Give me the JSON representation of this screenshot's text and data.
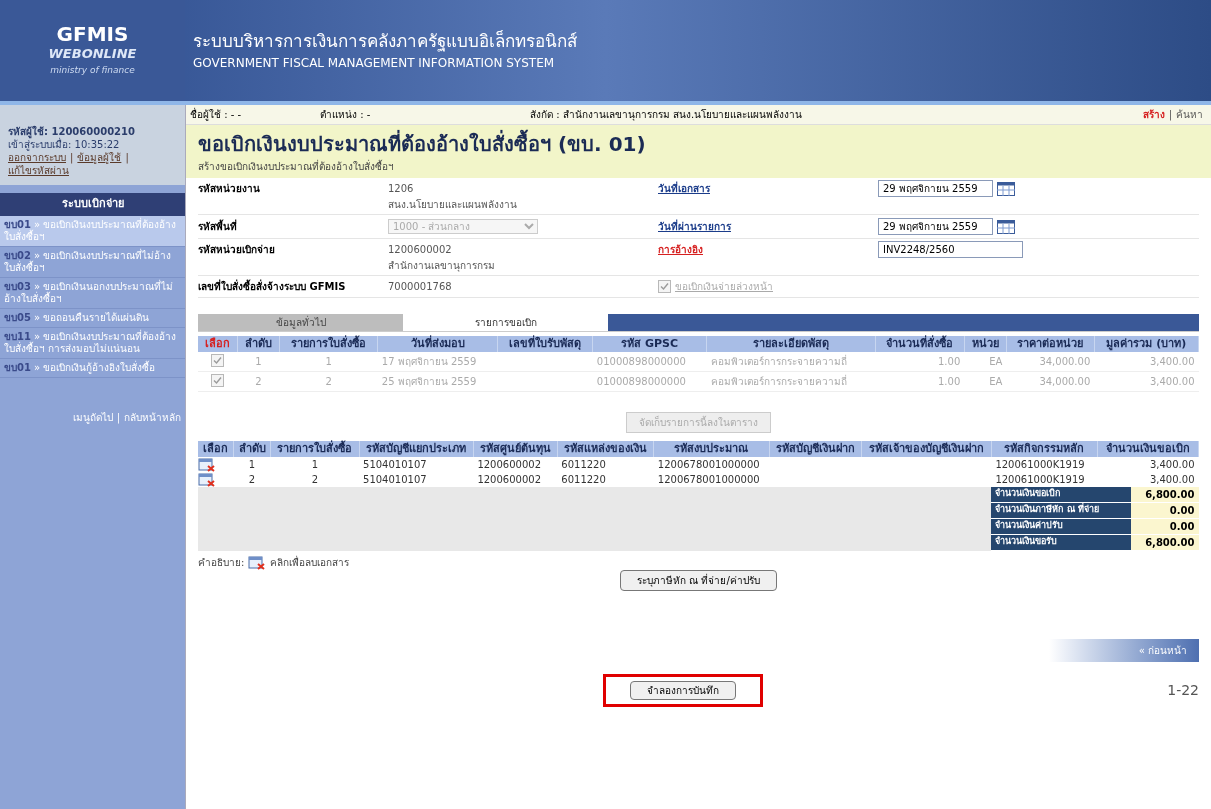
{
  "header": {
    "logo_line1": "GFMIS",
    "logo_line2": "WEBONLINE",
    "logo_line3": "ministry of finance",
    "title_th": "ระบบบริหารการเงินการคลังภาครัฐแบบอิเล็กทรอนิกส์",
    "title_en": "GOVERNMENT FISCAL MANAGEMENT INFORMATION SYSTEM"
  },
  "sidebar": {
    "user_id": "รหัสผู้ใช้: 120060000210",
    "login_time_label": "เข้าสู่ระบบเมื่อ:",
    "login_time": "10:35:22",
    "links": [
      "ออกจากระบบ",
      "ข้อมูลผู้ใช้",
      "แก้ไขรหัสผ่าน"
    ],
    "separator": "|",
    "menu_title": "ระบบเบิกจ่าย",
    "items": [
      {
        "code": "ขบ01",
        "label": "» ขอเบิกเงินงบประมาณที่ต้องอ้างใบสั่งซื้อฯ",
        "selected": true
      },
      {
        "code": "ขบ02",
        "label": "» ขอเบิกเงินงบประมาณที่ไม่อ้างใบสั่งซื้อฯ",
        "selected": false
      },
      {
        "code": "ขบ03",
        "label": "» ขอเบิกเงินนอกงบประมาณที่ไม่อ้างใบสั่งซื้อฯ",
        "selected": false
      },
      {
        "code": "ขบ05",
        "label": "» ขอถอนคืนรายได้แผ่นดิน",
        "selected": false
      },
      {
        "code": "ขบ11",
        "label": "» ขอเบิกเงินงบประมาณที่ต้องอ้างใบสั่งซื้อฯ การส่งมอบไม่แน่นอน",
        "selected": false
      },
      {
        "code": "ขบ01",
        "label": "» ขอเบิกเงินกู้อ้างอิงใบสั่งซื้อ",
        "selected": false
      }
    ],
    "footer_links": [
      "เมนูถัดไป",
      "กลับหน้าหลัก"
    ]
  },
  "top_bar": {
    "user_label": "ชื่อผู้ใช้ :",
    "user_value": "- -",
    "position_label": "ตำแหน่ง :",
    "position_value": "-",
    "affiliation_label": "สังกัด :",
    "affiliation_value": "สำนักงานเลขานุการกรม สนง.นโยบายและแผนพลังงาน",
    "actions": [
      {
        "label": "สร้าง",
        "selected": true
      },
      {
        "label": "ค้นหา",
        "selected": false
      }
    ],
    "separator": "|"
  },
  "page": {
    "title": "ขอเบิกเงินงบประมาณที่ต้องอ้างใบสั่งซื้อฯ (ขบ. 01)",
    "subtitle": "สร้างขอเบิกเงินงบประมาณที่ต้องอ้างใบสั่งซื้อฯ"
  },
  "form": {
    "agency_label": "รหัสหน่วยงาน",
    "agency_code": "1206",
    "agency_name": "สนง.นโยบายและแผนพลังงาน",
    "doc_date_label": "วันที่เอกสาร",
    "doc_date": "29 พฤศจิกายน 2559",
    "area_label": "รหัสพื้นที่",
    "area_value": "1000 - ส่วนกลาง",
    "post_date_label": "วันที่ผ่านรายการ",
    "post_date": "29 พฤศจิกายน 2559",
    "unit_label": "รหัสหน่วยเบิกจ่าย",
    "unit_code": "1200600002",
    "unit_name": "สำนักงานเลขานุการกรม",
    "reference_label": "การอ้างอิง",
    "reference": "INV2248/2560",
    "po_label": "เลขที่ใบสั่งซื้อสั่งจ้างระบบ GFMIS",
    "po_number": "7000001768",
    "advance_label": "ขอเบิกเงินจ่ายล่วงหน้า",
    "advance_checked": true
  },
  "tabs": [
    {
      "label": "ข้อมูลทั่วไป",
      "selected": false
    },
    {
      "label": "รายการขอเบิก",
      "selected": true
    }
  ],
  "items_table": {
    "columns": [
      "เลือก",
      "ลำดับ",
      "รายการใบสั่งซื้อ",
      "วันที่ส่งมอบ",
      "เลขที่ใบรับพัสดุ",
      "รหัส GPSC",
      "รายละเอียดพัสดุ",
      "จำนวนที่สั่งซื้อ",
      "หน่วย",
      "ราคาต่อหน่วย",
      "มูลค่ารวม (บาท)"
    ],
    "rows": [
      {
        "checked": true,
        "cells": [
          "",
          "1",
          "1",
          "17 พฤศจิกายน 2559",
          "",
          "01000898000000",
          "คอมพิวเตอร์การกระจายความถี่",
          "1.00",
          "EA",
          "34,000.00",
          "3,400.00"
        ]
      },
      {
        "checked": true,
        "cells": [
          "",
          "2",
          "2",
          "25 พฤศจิกายน 2559",
          "",
          "01000898000000",
          "คอมพิวเตอร์การกระจายความถี่",
          "1.00",
          "EA",
          "34,000.00",
          "3,400.00"
        ]
      }
    ]
  },
  "store_button": "จัดเก็บรายการนี้ลงในตาราง",
  "accounts_table": {
    "columns": [
      "เลือก",
      "ลำดับ",
      "รายการใบสั่งซื้อ",
      "รหัสบัญชีแยกประเภท",
      "รหัสศูนย์ต้นทุน",
      "รหัสแหล่งของเงิน",
      "รหัสงบประมาณ",
      "รหัสบัญชีเงินฝาก",
      "รหัสเจ้าของบัญชีเงินฝาก",
      "รหัสกิจกรรมหลัก",
      "จำนวนเงินขอเบิก"
    ],
    "rows": [
      [
        "",
        "1",
        "1",
        "5104010107",
        "1200600002",
        "6011220",
        "1200678001000000",
        "",
        "",
        "120061000K1919",
        "3,400.00"
      ],
      [
        "",
        "2",
        "2",
        "5104010107",
        "1200600002",
        "6011220",
        "1200678001000000",
        "",
        "",
        "120061000K1919",
        "3,400.00"
      ]
    ],
    "totals": [
      {
        "label": "จำนวนเงินขอเบิก",
        "value": "6,800.00"
      },
      {
        "label": "จำนวนเงินภาษีหัก ณ ที่จ่าย",
        "value": "0.00"
      },
      {
        "label": "จำนวนเงินค่าปรับ",
        "value": "0.00"
      },
      {
        "label": "จำนวนเงินขอรับ",
        "value": "6,800.00"
      }
    ]
  },
  "legend": {
    "label": "คำอธิบาย:",
    "text": "คลิกเพื่อลบเอกสาร"
  },
  "tax_button": "ระบุภาษีหัก ณ ที่จ่าย/ค่าปรับ",
  "back_link": "« ก่อนหน้า",
  "save_button": "จำลองการบันทึก",
  "page_number": "1-22"
}
